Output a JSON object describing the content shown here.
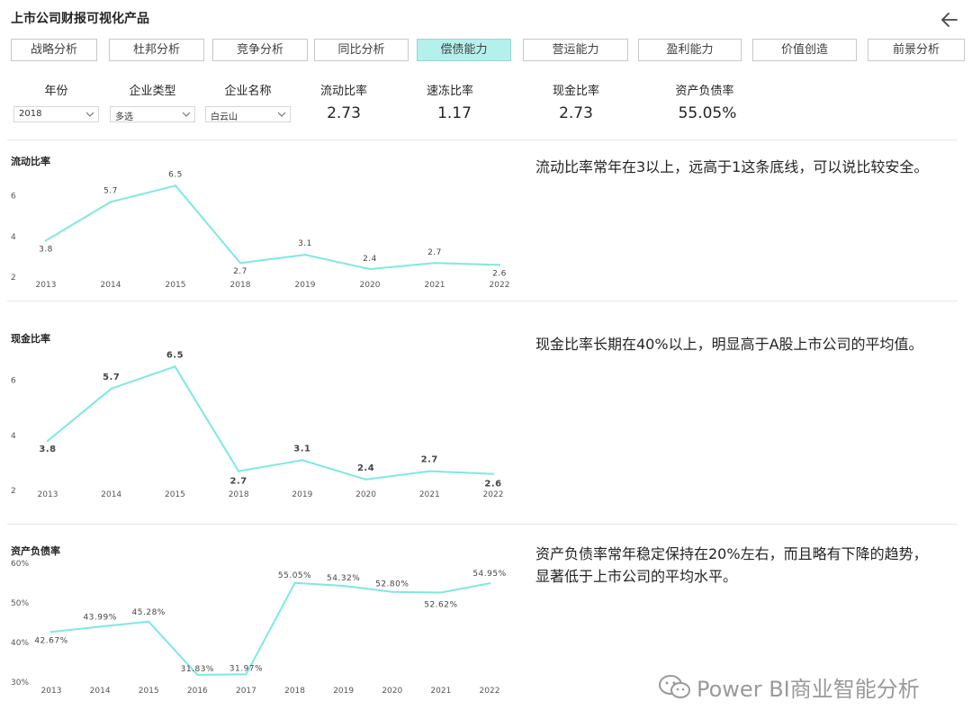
{
  "app": {
    "title": "上市公司财报可视化产品",
    "back_icon": "arrow-left-icon"
  },
  "tabs": [
    {
      "label": "战略分析",
      "active": false
    },
    {
      "label": "杜邦分析",
      "active": false
    },
    {
      "label": "竞争分析",
      "active": false
    },
    {
      "label": "同比分析",
      "active": false
    },
    {
      "label": "偿债能力",
      "active": true
    },
    {
      "label": "营运能力",
      "active": false
    },
    {
      "label": "盈利能力",
      "active": false
    },
    {
      "label": "价值创造",
      "active": false
    },
    {
      "label": "前景分析",
      "active": false
    }
  ],
  "filters": {
    "year": {
      "label": "年份",
      "value": "2018"
    },
    "company_type": {
      "label": "企业类型",
      "value": "多选"
    },
    "company_name": {
      "label": "企业名称",
      "value": "白云山"
    }
  },
  "kpis": {
    "current_ratio": {
      "label": "流动比率",
      "value": "2.73"
    },
    "quick_ratio": {
      "label": "速冻比率",
      "value": "1.17"
    },
    "cash_ratio": {
      "label": "现金比率",
      "value": "2.73"
    },
    "debt_ratio": {
      "label": "资产负债率",
      "value": "55.05%"
    }
  },
  "colors": {
    "accent": "#7ee8e2",
    "active_tab": "#b5f1ec"
  },
  "commentary": {
    "current_ratio": "流动比率常年在3以上，远高于1这条底线，可以说比较安全。",
    "cash_ratio": "现金比率长期在40%以上，明显高于A股上市公司的平均值。",
    "debt_ratio": "资产负债率常年稳定保持在20%左右，而且略有下降的趋势，显著低于上市公司的平均水平。"
  },
  "watermark": {
    "icon": "wechat-icon",
    "text": "Power BI商业智能分析"
  },
  "chart_data": [
    {
      "type": "line",
      "title": "流动比率",
      "categories": [
        "2013",
        "2014",
        "2015",
        "2018",
        "2019",
        "2020",
        "2021",
        "2022"
      ],
      "values": [
        3.8,
        5.7,
        6.5,
        2.7,
        3.1,
        2.4,
        2.7,
        2.6
      ],
      "labels": [
        "3.8",
        "5.7",
        "6.5",
        "2.7",
        "3.1",
        "2.4",
        "2.7",
        "2.6"
      ],
      "ylim": [
        2,
        7
      ],
      "yticks": [
        2,
        4,
        6
      ],
      "ytick_labels": [
        "2",
        "4",
        "6"
      ],
      "color": "#7ee8e2"
    },
    {
      "type": "line",
      "title": "现金比率",
      "categories": [
        "2013",
        "2014",
        "2015",
        "2018",
        "2019",
        "2020",
        "2021",
        "2022"
      ],
      "values": [
        3.8,
        5.7,
        6.5,
        2.7,
        3.1,
        2.4,
        2.7,
        2.6
      ],
      "labels": [
        "3.8",
        "5.7",
        "6.5",
        "2.7",
        "3.1",
        "2.4",
        "2.7",
        "2.6"
      ],
      "ylim": [
        2,
        7
      ],
      "yticks": [
        2,
        4,
        6
      ],
      "ytick_labels": [
        "2",
        "4",
        "6"
      ],
      "color": "#7ee8e2"
    },
    {
      "type": "line",
      "title": "资产负债率",
      "categories": [
        "2013",
        "2014",
        "2015",
        "2016",
        "2017",
        "2018",
        "2019",
        "2020",
        "2021",
        "2022"
      ],
      "values": [
        42.67,
        43.99,
        45.28,
        31.83,
        31.97,
        55.05,
        54.32,
        52.8,
        52.62,
        54.95
      ],
      "labels": [
        "42.67%",
        "43.99%",
        "45.28%",
        "31.83%",
        "31.97%",
        "55.05%",
        "54.32%",
        "52.80%",
        "52.62%",
        "54.95%"
      ],
      "ylim": [
        30,
        60
      ],
      "yticks": [
        30,
        40,
        50,
        60
      ],
      "ytick_labels": [
        "30%",
        "40%",
        "50%",
        "60%"
      ],
      "color": "#7ee8e2"
    }
  ]
}
